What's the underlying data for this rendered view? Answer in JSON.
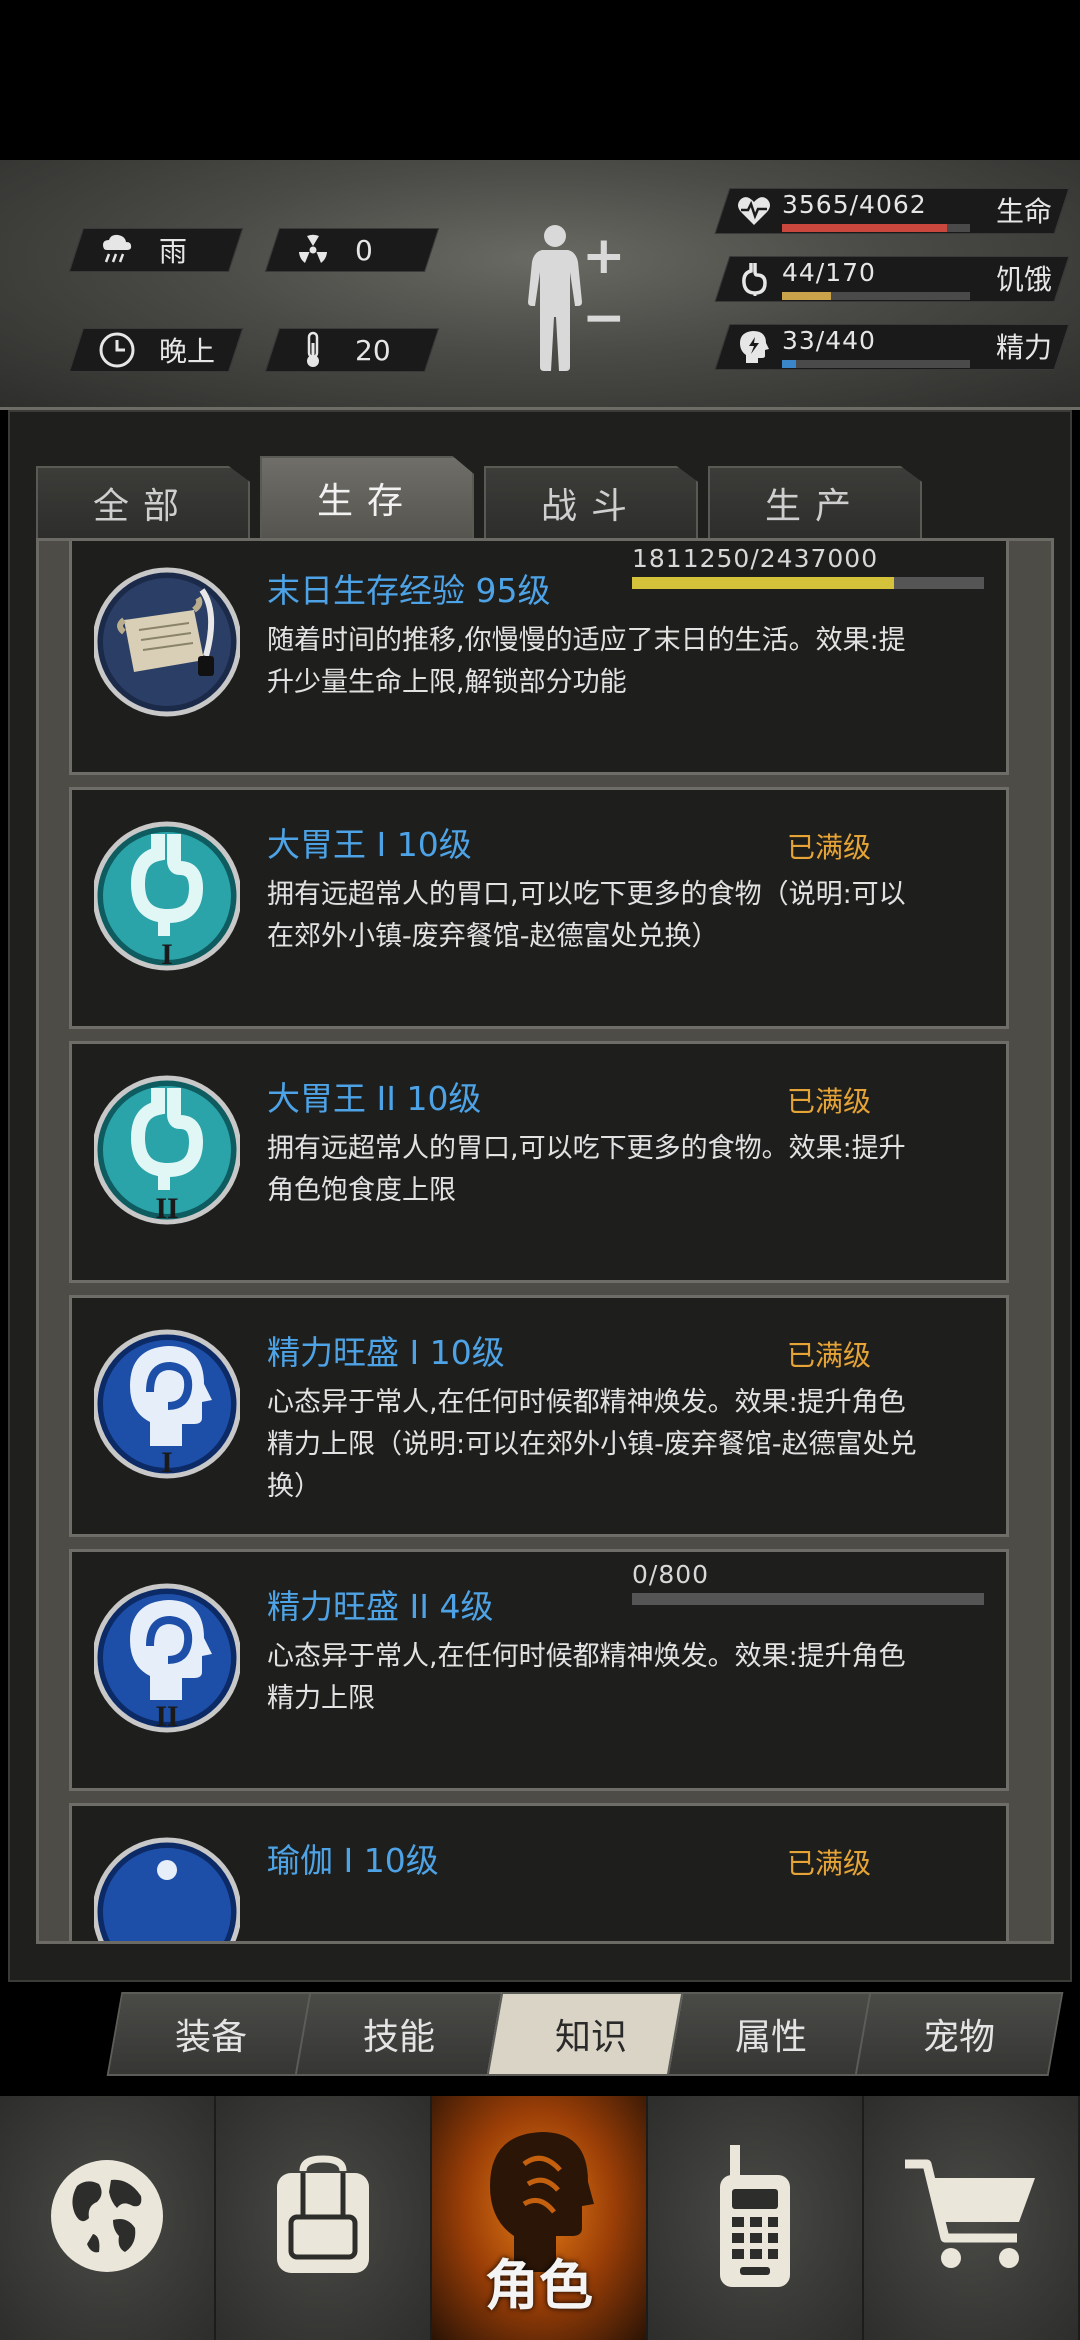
{
  "environment": {
    "weather": "雨",
    "radiation": "0",
    "time_of_day": "晚上",
    "temperature": "20"
  },
  "vitals": [
    {
      "id": "health",
      "value": "3565/4062",
      "label": "生命",
      "ratio": 0.878,
      "color": "#c9473c",
      "icon": "heart-icon"
    },
    {
      "id": "hunger",
      "value": "44/170",
      "label": "饥饿",
      "ratio": 0.259,
      "color": "#c9a24a",
      "icon": "stomach-icon"
    },
    {
      "id": "energy",
      "value": "33/440",
      "label": "精力",
      "ratio": 0.075,
      "color": "#3a86c8",
      "icon": "brain-icon"
    }
  ],
  "category_tabs": [
    "全部",
    "生存",
    "战斗",
    "生产"
  ],
  "active_category_tab": 1,
  "skills": [
    {
      "title": "末日生存经验 95级",
      "desc": "随着时间的推移,你慢慢的适应了末日的生活。效果:提升少量生命上限,解锁部分功能",
      "progress_text": "1811250/2437000",
      "progress": 0.743,
      "max": "",
      "icon": "scroll-icon"
    },
    {
      "title": "大胃王 I 10级",
      "desc": "拥有远超常人的胃口,可以吃下更多的食物（说明:可以在郊外小镇-废弃餐馆-赵德富处兑换）",
      "progress_text": "",
      "progress": null,
      "max": "已满级",
      "icon": "stomach-i-icon"
    },
    {
      "title": "大胃王 II 10级",
      "desc": "拥有远超常人的胃口,可以吃下更多的食物。效果:提升角色饱食度上限",
      "progress_text": "",
      "progress": null,
      "max": "已满级",
      "icon": "stomach-ii-icon"
    },
    {
      "title": "精力旺盛 I 10级",
      "desc": "心态异于常人,在任何时候都精神焕发。效果:提升角色精力上限（说明:可以在郊外小镇-废弃餐馆-赵德富处兑换）",
      "progress_text": "",
      "progress": null,
      "max": "已满级",
      "icon": "head-i-icon"
    },
    {
      "title": "精力旺盛 II 4级",
      "desc": "心态异于常人,在任何时候都精神焕发。效果:提升角色精力上限",
      "progress_text": "0/800",
      "progress": 0.0,
      "max": "",
      "icon": "head-ii-icon"
    },
    {
      "title": "瑜伽 I 10级",
      "desc": "",
      "progress_text": "",
      "progress": null,
      "max": "已满级",
      "icon": "yoga-icon"
    }
  ],
  "sub_tabs": [
    "装备",
    "技能",
    "知识",
    "属性",
    "宠物"
  ],
  "active_sub_tab": 2,
  "bottom_nav": [
    {
      "name": "globe-icon",
      "label": ""
    },
    {
      "name": "backpack-icon",
      "label": ""
    },
    {
      "name": "character-icon",
      "label": "角色"
    },
    {
      "name": "walkie-talkie-icon",
      "label": ""
    },
    {
      "name": "cart-icon",
      "label": ""
    }
  ],
  "active_bottom_nav": 2
}
